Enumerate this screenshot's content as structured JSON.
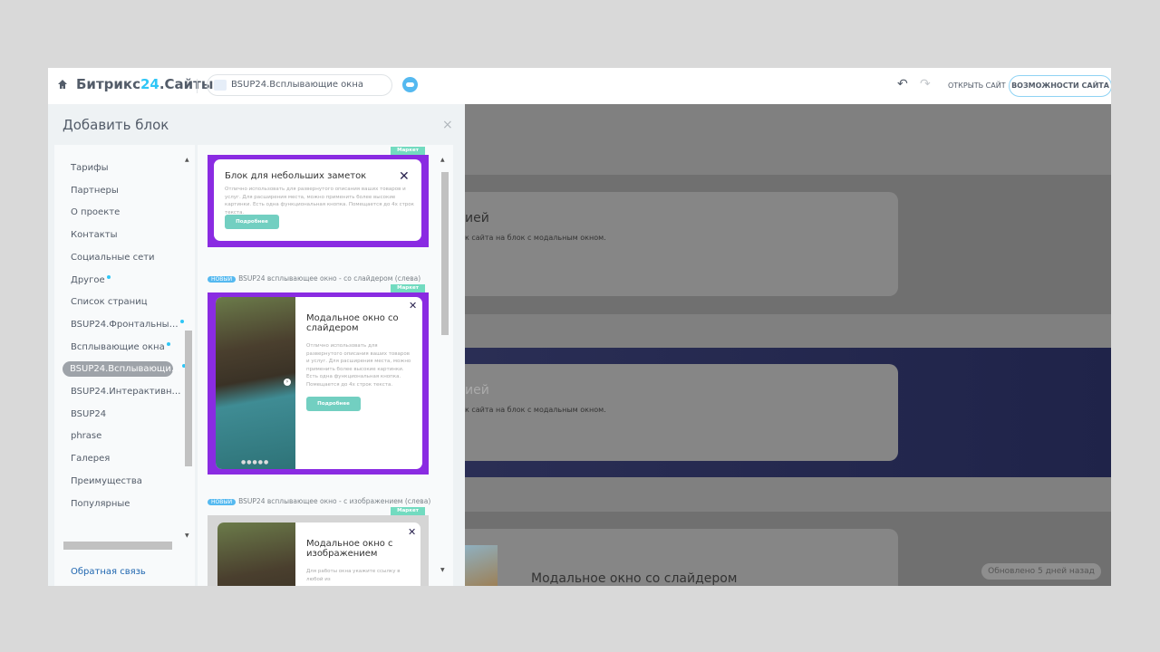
{
  "header": {
    "brand_prefix": "Битрикс",
    "brand_num": "24",
    "brand_suffix": ".Сайты",
    "site_name": "BSUP24.Всплывающие окна",
    "open_site": "ОТКРЫТЬ САЙТ",
    "site_features": "ВОЗМОЖНОСТИ САЙТА",
    "undo_icon": "↶",
    "redo_icon": "↷"
  },
  "panel": {
    "title": "Добавить блок",
    "close": "×",
    "categories": [
      {
        "label": "Тарифы"
      },
      {
        "label": "Партнеры"
      },
      {
        "label": "О проекте"
      },
      {
        "label": "Контакты"
      },
      {
        "label": "Социальные сети"
      },
      {
        "label": "Другое",
        "dot": true
      },
      {
        "label": "Список страниц"
      },
      {
        "label": "BSUP24.Фронтальны…",
        "dot": true
      },
      {
        "label": "Всплывающие окна",
        "dot": true
      },
      {
        "label": "BSUP24.Всплывающи…",
        "dot": true,
        "active": true
      },
      {
        "label": "BSUP24.Интерактивн…"
      },
      {
        "label": "BSUP24"
      },
      {
        "label": "phrase"
      },
      {
        "label": "Галерея"
      },
      {
        "label": "Преимущества"
      },
      {
        "label": "Популярные"
      }
    ],
    "feedback": "Обратная связь",
    "blocks": [
      {
        "title": "Блок для небольших заметок",
        "desc": "Отлично использовать для развернутого описания ваших товаров и услуг. Для расширения места, можно применить более высокие картинки. Есть одна функциональная кнопка. Помещается до 4х строк текста.",
        "button": "Подробнее",
        "badge": "Маркет"
      },
      {
        "new": "НОВЫЙ",
        "label": "BSUP24 всплывающее окно - со слайдером (слева)",
        "badge": "Маркет",
        "title": "Модальное окно со слайдером",
        "desc": "Отлично использовать для развернутого описания ваших товаров и услуг. Для расширения места, можно применить более высокие картинки. Есть одна функциональная кнопка. Помещается до 4х строк текста.",
        "button": "Подробнее"
      },
      {
        "new": "НОВЫЙ",
        "label": "BSUP24 всплывающее окно - с изображением (слева)",
        "badge": "Маркет",
        "title": "Модальное окно с изображением",
        "desc": "Для работы окна укажите ссылку в любой из"
      }
    ]
  },
  "main": {
    "sections": [
      {
        "title": "ией",
        "text": "к сайта на блок с модальным окном."
      },
      {
        "title": "ией",
        "text": "к сайта на блок с модальным окном."
      },
      {
        "title": "Модальное окно со слайдером"
      }
    ],
    "updated": "Обновлено 5 дней назад"
  },
  "colors": {
    "accent": "#2fc6f6",
    "frame": "#8a2be2",
    "button": "#72cfc1"
  }
}
